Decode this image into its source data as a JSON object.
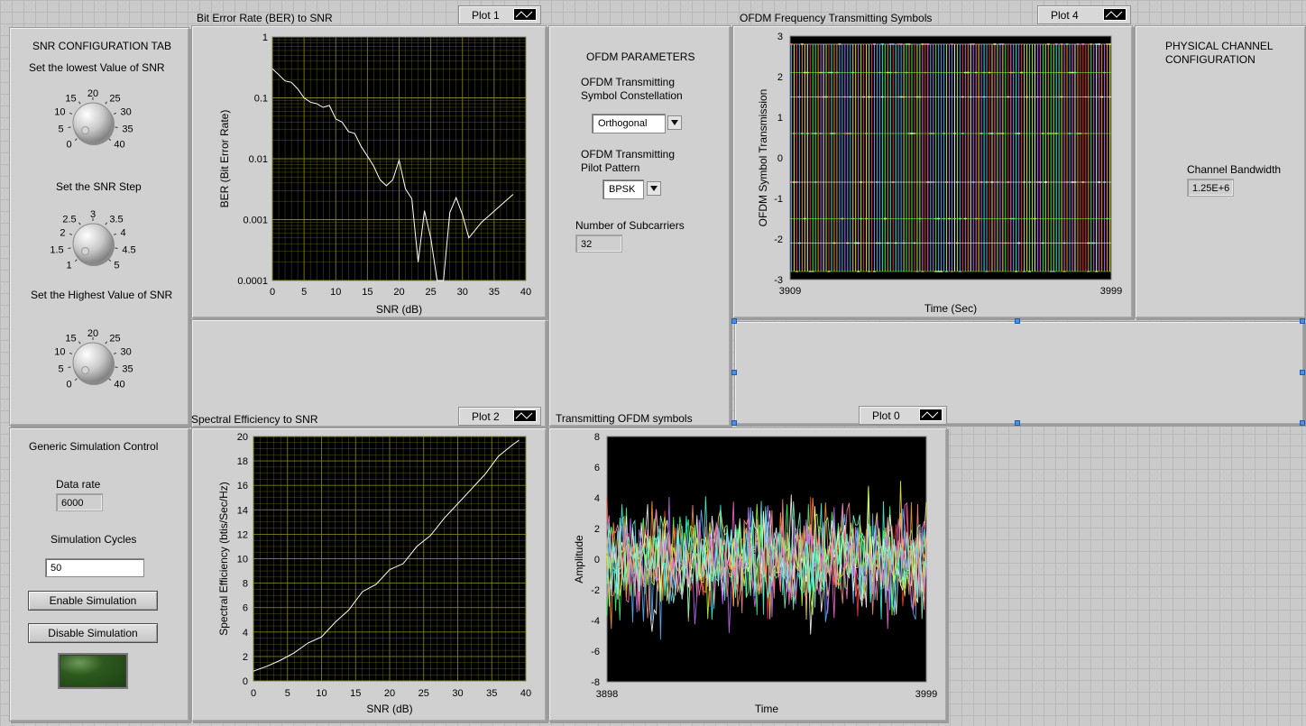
{
  "snr_tab": {
    "title": "SNR CONFIGURATION TAB",
    "knob1": {
      "label": "Set the lowest Value of SNR",
      "ticks": [
        "0",
        "5",
        "10",
        "15",
        "20",
        "25",
        "30",
        "35",
        "40"
      ]
    },
    "knob2": {
      "label": "Set the SNR Step",
      "ticks": [
        "1",
        "1.5",
        "2",
        "2.5",
        "3",
        "3.5",
        "4",
        "4.5",
        "5"
      ]
    },
    "knob3": {
      "label": "Set the Highest Value of SNR",
      "ticks": [
        "0",
        "5",
        "10",
        "15",
        "20",
        "25",
        "30",
        "35",
        "40"
      ]
    }
  },
  "sim_control": {
    "title": "Generic Simulation Control",
    "data_rate_label": "Data rate",
    "data_rate_value": "6000",
    "cycles_label": "Simulation Cycles",
    "cycles_value": "50",
    "enable_label": "Enable Simulation",
    "disable_label": "Disable Simulation"
  },
  "ofdm_params": {
    "title": "OFDM PARAMETERS",
    "constellation_label": "OFDM Transmitting Symbol Constellation",
    "constellation_value": "Orthogonal",
    "pilot_label": "OFDM Transmitting Pilot Pattern",
    "pilot_value": "BPSK",
    "subcarriers_label": "Number of Subcarriers",
    "subcarriers_value": "32"
  },
  "physical_channel": {
    "title": "PHYSICAL CHANNEL CONFIGURATION",
    "bandwidth_label": "Channel Bandwidth",
    "bandwidth_value": "1.25E+6"
  },
  "colors": {
    "graph_bg": "#000000",
    "grid": "#8b8b22",
    "trace": "#ffffff"
  },
  "chart_data": [
    {
      "id": "ber",
      "type": "line",
      "title": "Bit Error Rate (BER) to SNR",
      "plot_label": "Plot 1",
      "xlabel": "SNR (dB)",
      "ylabel": "BER (Bit Error Rate)",
      "xscale": "linear",
      "yscale": "log",
      "xlim": [
        0,
        40
      ],
      "ylim": [
        0.0001,
        1
      ],
      "xticks": [
        "0",
        "5",
        "10",
        "15",
        "20",
        "25",
        "30",
        "35",
        "40"
      ],
      "yticks": [
        "0.0001",
        "0.001",
        "0.01",
        "0.1",
        "1"
      ],
      "x": [
        0,
        1,
        2,
        3,
        4,
        5,
        6,
        7,
        8,
        9,
        10,
        11,
        12,
        13,
        14,
        15,
        16,
        17,
        18,
        19,
        20,
        21,
        22,
        23,
        24,
        25,
        26,
        27,
        28,
        29,
        30,
        31,
        33,
        38
      ],
      "y": [
        0.3,
        0.24,
        0.19,
        0.18,
        0.14,
        0.1,
        0.085,
        0.08,
        0.07,
        0.075,
        0.045,
        0.04,
        0.028,
        0.026,
        0.016,
        0.011,
        0.0075,
        0.0045,
        0.0036,
        0.0045,
        0.0095,
        0.0032,
        0.0022,
        0.0002,
        0.0014,
        0.0005,
        0.0001,
        0.0001,
        0.0013,
        0.0023,
        0.0012,
        0.0005,
        0.0009,
        0.0026
      ],
      "grid": true
    },
    {
      "id": "se",
      "type": "line",
      "title": "Spectral Efficiency to SNR",
      "plot_label": "Plot 2",
      "xlabel": "SNR (dB)",
      "ylabel": "Spectral Efficiency (btis/Sec/Hz)",
      "xlim": [
        0,
        40
      ],
      "ylim": [
        0,
        20
      ],
      "xticks": [
        "0",
        "5",
        "10",
        "15",
        "20",
        "25",
        "30",
        "35",
        "40"
      ],
      "yticks": [
        "0",
        "2",
        "4",
        "6",
        "8",
        "10",
        "12",
        "14",
        "16",
        "18",
        "20"
      ],
      "x": [
        0,
        2,
        4,
        6,
        8,
        10,
        12,
        14,
        16,
        18,
        20,
        22,
        24,
        26,
        28,
        30,
        32,
        34,
        36,
        38,
        39
      ],
      "y": [
        0.8,
        1.2,
        1.7,
        2.3,
        3.1,
        3.6,
        4.8,
        5.8,
        7.3,
        7.9,
        9.1,
        9.6,
        11.0,
        11.9,
        13.3,
        14.5,
        15.7,
        16.9,
        18.4,
        19.3,
        19.7
      ],
      "grid": true
    },
    {
      "id": "freq",
      "type": "line",
      "title": "OFDM Frequency Transmitting Symbols",
      "plot_label": "Plot 4",
      "xlabel": "Time (Sec)",
      "ylabel": "OFDM Symbol Transmission",
      "xlim": [
        3909,
        3999
      ],
      "ylim": [
        -3,
        3
      ],
      "xticks": [
        "3909",
        "3999"
      ],
      "yticks": [
        "-3",
        "-2",
        "-1",
        "0",
        "1",
        "2",
        "3"
      ],
      "levels": [
        2.8,
        2.1,
        1.5,
        0.6,
        -0.6,
        -1.5,
        -2.1,
        -2.8
      ],
      "grid": false
    },
    {
      "id": "time",
      "type": "line",
      "title": "Transmitting OFDM symbols",
      "plot_label": "Plot 0",
      "xlabel": "Time",
      "ylabel": "Amplitude",
      "xlim": [
        3898,
        3999
      ],
      "ylim": [
        -8,
        8
      ],
      "xticks": [
        "3898",
        "3999"
      ],
      "yticks": [
        "-8",
        "-6",
        "-4",
        "-2",
        "0",
        "2",
        "4",
        "6",
        "8"
      ],
      "grid": false
    }
  ]
}
